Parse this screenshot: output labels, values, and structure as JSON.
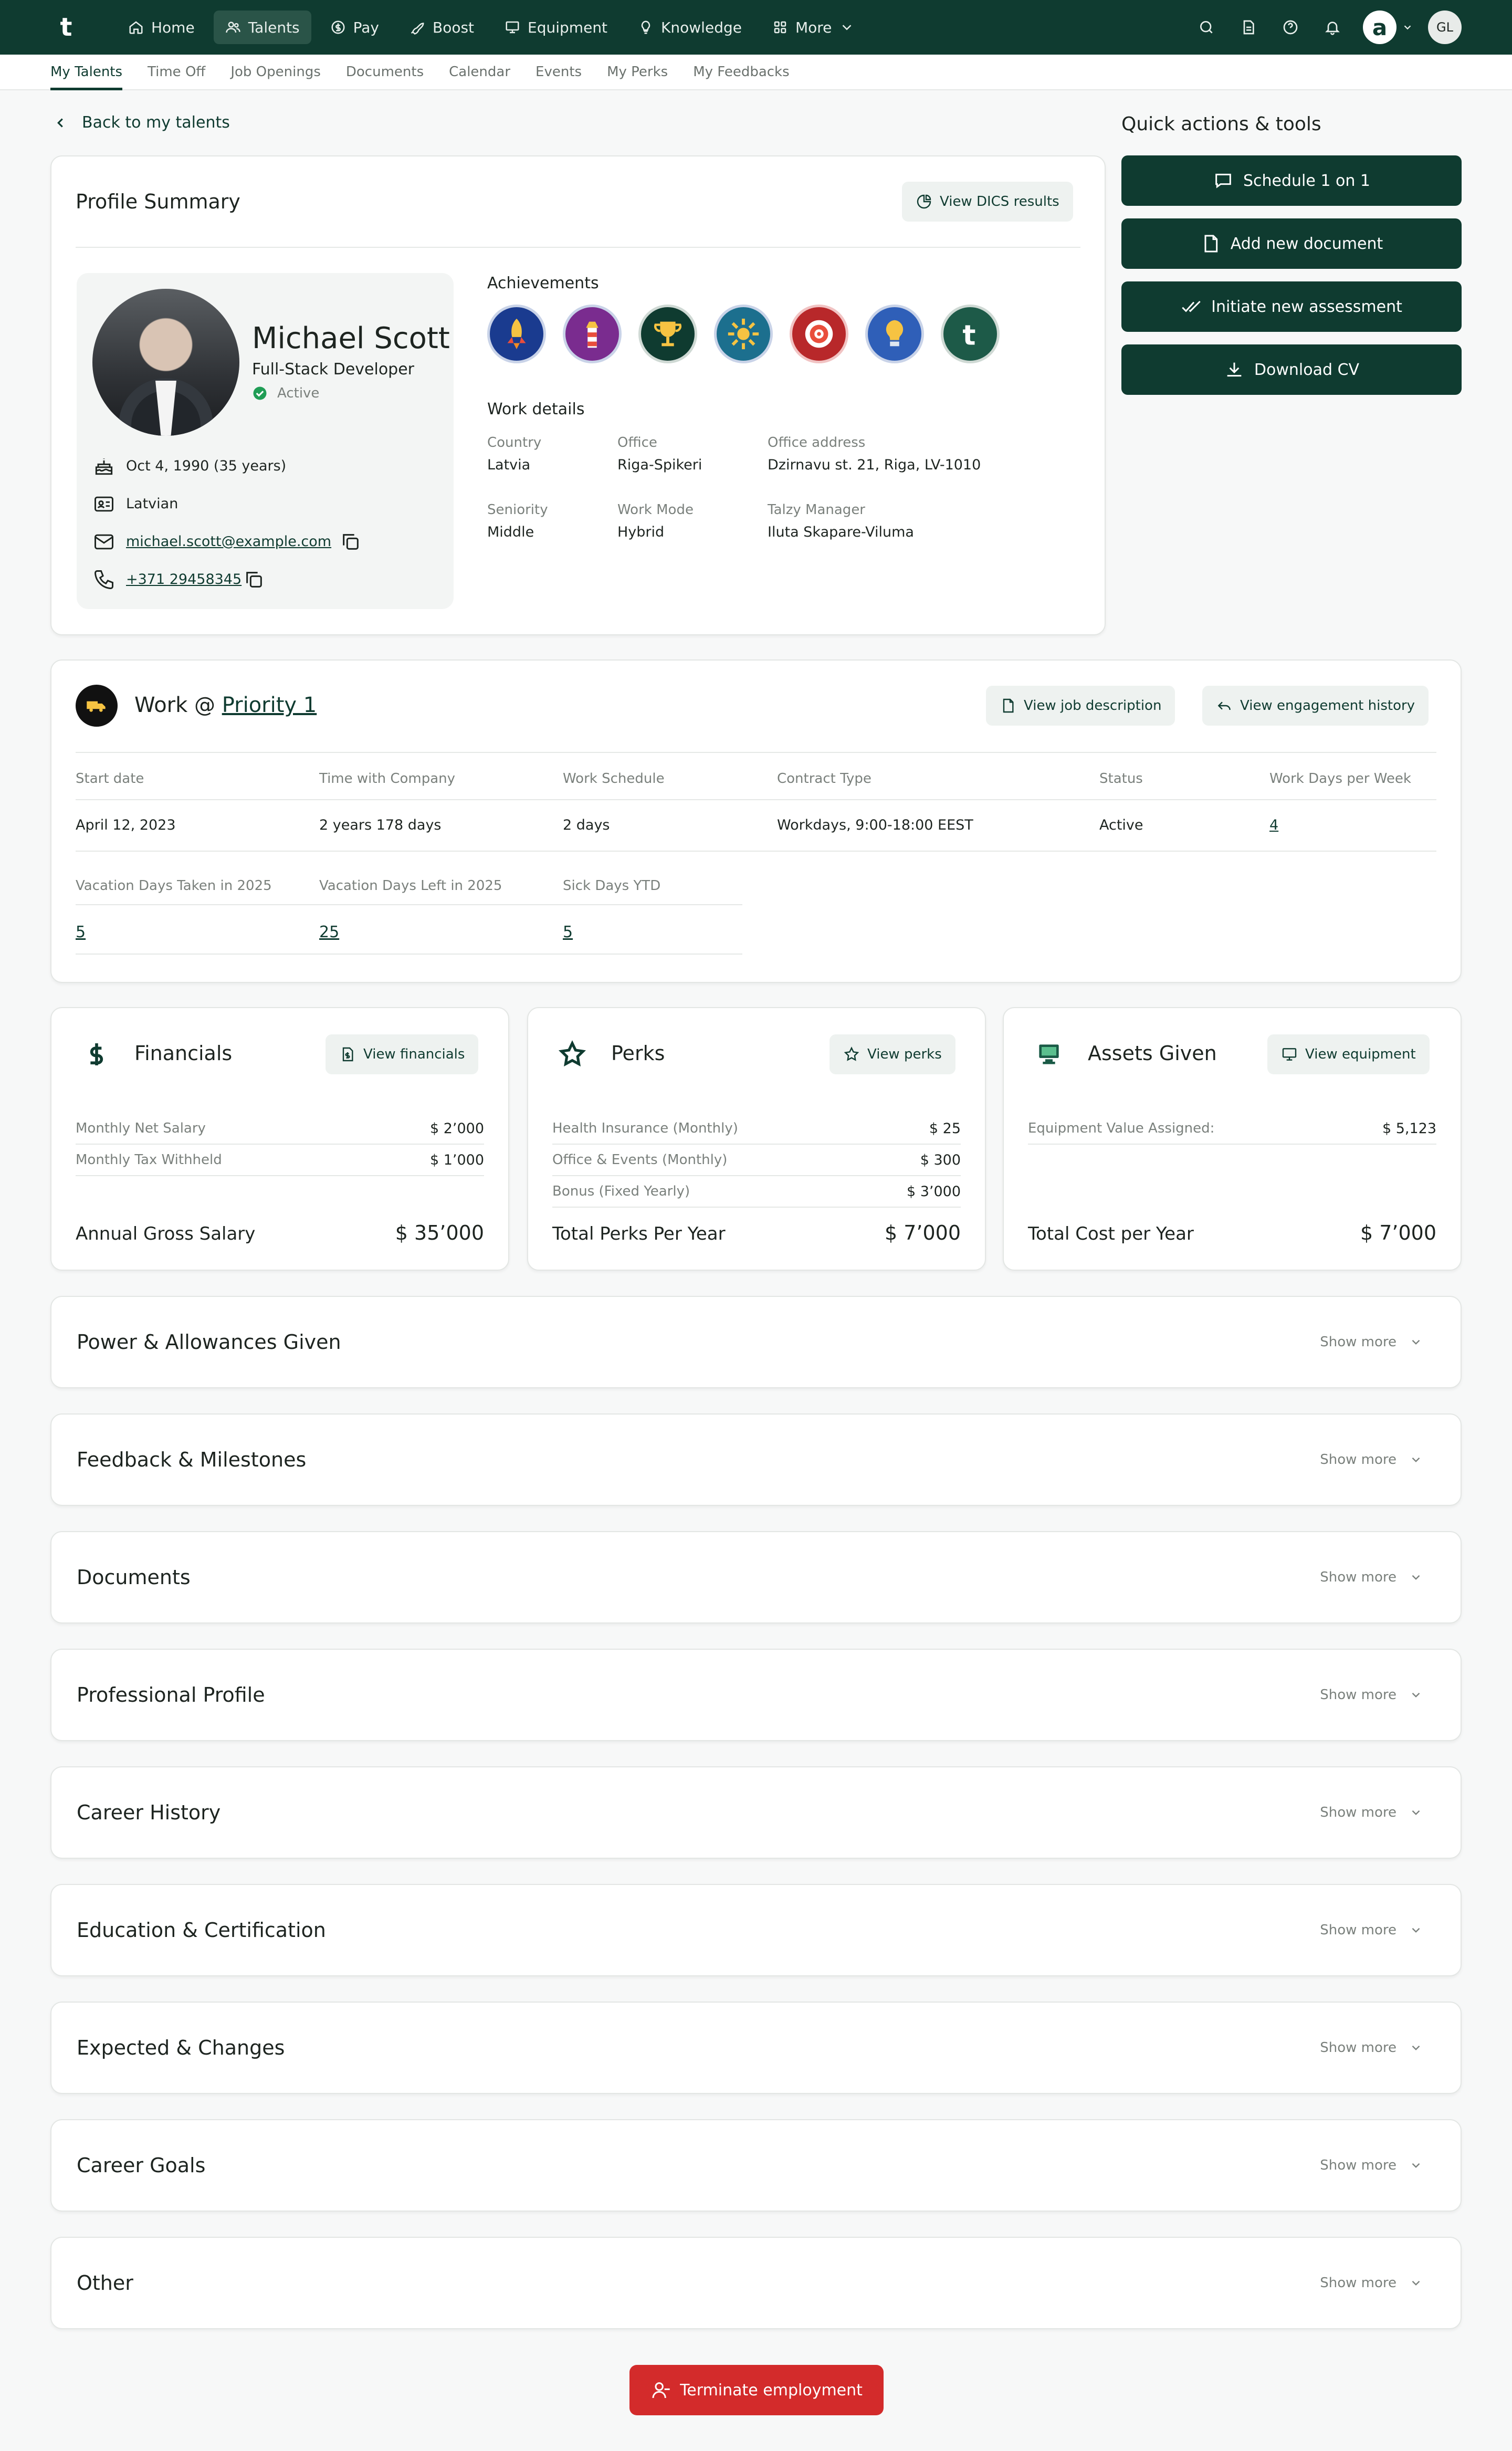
{
  "nav": {
    "logo": "t",
    "items": [
      {
        "label": "Home",
        "icon": "home-icon"
      },
      {
        "label": "Talents",
        "icon": "users-icon",
        "active": true
      },
      {
        "label": "Pay",
        "icon": "dollar-icon"
      },
      {
        "label": "Boost",
        "icon": "rocket-icon"
      },
      {
        "label": "Equipment",
        "icon": "monitor-icon"
      },
      {
        "label": "Knowledge",
        "icon": "lightbulb-icon"
      },
      {
        "label": "More",
        "icon": "grid-icon"
      }
    ],
    "company_initial": "a",
    "user_initials": "GL"
  },
  "subtabs": [
    "My Talents",
    "Time Off",
    "Job Openings",
    "Documents",
    "Calendar",
    "Events",
    "My Perks",
    "My Feedbacks"
  ],
  "back_link": "Back to my talents",
  "quick_actions": {
    "title": "Quick actions & tools",
    "buttons": [
      "Schedule 1 on 1",
      "Add new document",
      "Initiate new assessment",
      "Download CV"
    ]
  },
  "profile": {
    "title": "Profile Summary",
    "dics_button": "View DICS results",
    "name": "Michael Scott",
    "role": "Full-Stack Developer",
    "status": "Active",
    "birthday": "Oct 4, 1990 (35 years)",
    "nationality": "Latvian",
    "email": "michael.scott@example.com",
    "phone": "+371 29458345",
    "achievements_title": "Achievements",
    "work_details_title": "Work details",
    "details": [
      {
        "label": "Country",
        "value": "Latvia"
      },
      {
        "label": "Office",
        "value": "Riga-Spikeri"
      },
      {
        "label": "Office address",
        "value": "Dzirnavu st. 21, Riga, LV-1010"
      },
      {
        "label": "Seniority",
        "value": "Middle"
      },
      {
        "label": "Work Mode",
        "value": "Hybrid"
      },
      {
        "label": "Talzy Manager",
        "value": "Iluta Skapare-Viluma"
      }
    ]
  },
  "work": {
    "title_prefix": "Work @ ",
    "company": "Priority 1",
    "job_desc_button": "View job description",
    "engagement_button": "View engagement history",
    "row1_headers": [
      "Start date",
      "Time with Company",
      "Work Schedule",
      "Contract Type",
      "Status",
      "Work Days per Week"
    ],
    "row1_values": [
      "April 12, 2023",
      "2 years 178 days",
      "2 days",
      "Workdays, 9:00-18:00 EEST",
      "Active",
      "4"
    ],
    "row2_headers": [
      "Vacation Days Taken in 2025",
      "Vacation Days Left in 2025",
      "Sick Days YTD"
    ],
    "row2_values": [
      "5",
      "25",
      "5"
    ]
  },
  "financials": {
    "title": "Financials",
    "button": "View financials",
    "rows": [
      {
        "label": "Monthly Net Salary",
        "value": "$ 2’000"
      },
      {
        "label": "Monthly Tax Withheld",
        "value": "$ 1’000"
      }
    ],
    "total_label": "Annual Gross Salary",
    "total_value": "$ 35’000"
  },
  "perks": {
    "title": "Perks",
    "button": "View perks",
    "rows": [
      {
        "label": "Health Insurance (Monthly)",
        "value": "$ 25"
      },
      {
        "label": "Office & Events (Monthly)",
        "value": "$ 300"
      },
      {
        "label": "Bonus (Fixed Yearly)",
        "value": "$ 3’000"
      }
    ],
    "total_label": "Total Perks Per Year",
    "total_value": "$ 7’000"
  },
  "assets": {
    "title": "Assets Given",
    "button": "View equipment",
    "rows": [
      {
        "label": "Equipment Value Assigned:",
        "value": "$ 5,123"
      }
    ],
    "total_label": "Total Cost per Year",
    "total_value": "$ 7’000"
  },
  "sections": [
    "Power & Allowances Given",
    "Feedback & Milestones",
    "Documents",
    "Professional Profile",
    "Career History",
    "Education & Certification",
    "Expected & Changes",
    "Career Goals",
    "Other"
  ],
  "show_more": "Show more",
  "terminate_button": "Terminate employment",
  "colors": {
    "brand": "#0f3b30",
    "danger": "#d32b2b",
    "status_active": "#1f9d55"
  }
}
